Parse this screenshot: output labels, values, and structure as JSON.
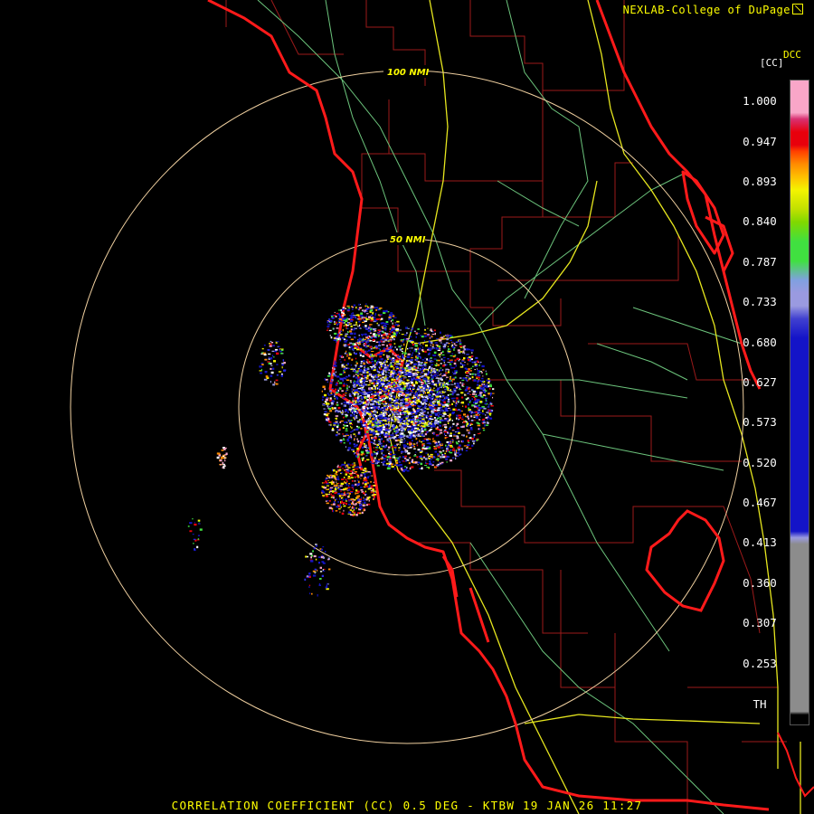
{
  "header": {
    "credit": "NEXLAB-College of DuPage",
    "credit_icon": "external-link-icon"
  },
  "legend": {
    "product_code": "DCC",
    "unit": "[CC]",
    "ticks": [
      "1.000",
      "0.947",
      "0.893",
      "0.840",
      "0.787",
      "0.733",
      "0.680",
      "0.627",
      "0.573",
      "0.520",
      "0.467",
      "0.413",
      "0.360",
      "0.307",
      "0.253",
      "TH"
    ],
    "colors": {
      "pink": "#f9a6c8",
      "red": "#e8000c",
      "orange": "#ff8c00",
      "yellow": "#f4f400",
      "green": "#40e040",
      "lavender": "#9a9ae0",
      "blue": "#1414c8",
      "gray": "#8c8c8c"
    }
  },
  "map": {
    "range_rings": [
      "100 NMI",
      "50 NMI"
    ],
    "colors": {
      "coastline": "#ff1a1a",
      "county_lines": "#9b1a1a",
      "roads_yellow": "#e6e61e",
      "roads_green": "#6cc47c",
      "rings": "#f0d0a0"
    }
  },
  "footer": {
    "title": "CORRELATION COEFFICIENT (CC) 0.5 DEG - KTBW 19 JAN 26 11:27"
  }
}
